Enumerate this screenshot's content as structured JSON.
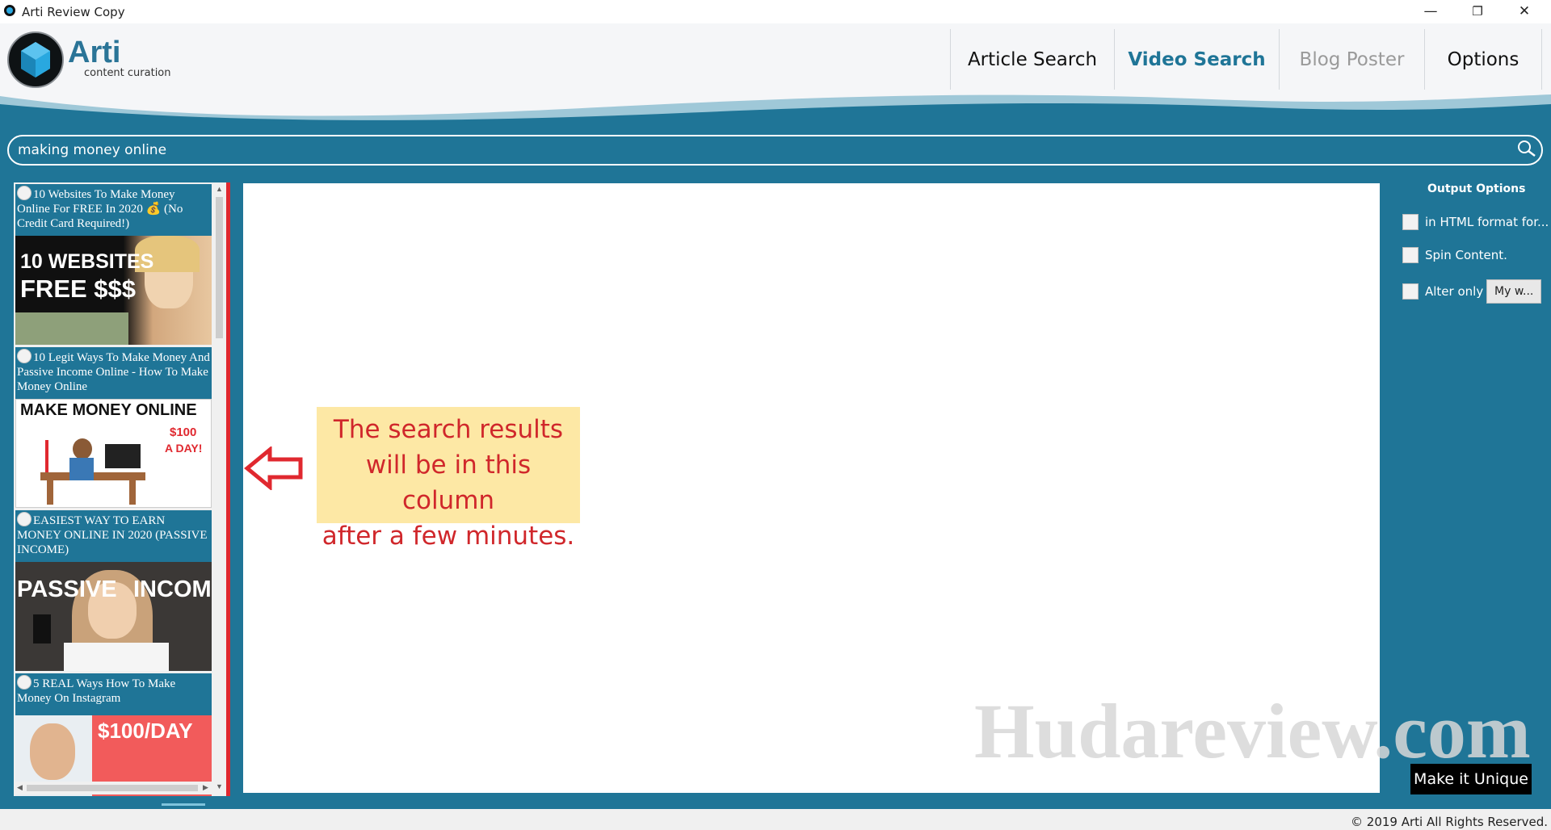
{
  "window": {
    "title": "Arti Review Copy",
    "controls": {
      "minimize": "—",
      "maximize": "❐",
      "close": "✕"
    }
  },
  "logo": {
    "name": "Arti",
    "tagline": "content curation"
  },
  "nav": [
    {
      "label": "Article Search",
      "state": "normal"
    },
    {
      "label": "Video Search",
      "state": "active"
    },
    {
      "label": "Blog Poster",
      "state": "disabled"
    },
    {
      "label": "Options",
      "state": "normal"
    }
  ],
  "search": {
    "value": "making money online",
    "icon": "search-icon"
  },
  "results": [
    {
      "title": "10 Websites To Make Money Online For FREE In 2020 💰 (No Credit Card Required!)",
      "thumb_text": [
        "10 WEBSITES",
        "FREE $$$"
      ]
    },
    {
      "title": "10 Legit Ways To Make Money And Passive Income Online - How To Make Money Online",
      "thumb_text": [
        "MAKE MONEY ONLINE",
        "$100",
        "A DAY!"
      ]
    },
    {
      "title": "EASIEST WAY TO EARN MONEY ONLINE IN 2020 (PASSIVE INCOME)",
      "thumb_text": [
        "PASSIVE",
        "INCOME"
      ]
    },
    {
      "title": "5 REAL Ways How To Make Money On Instagram",
      "thumb_text": [
        "$100/DAY"
      ]
    }
  ],
  "callout": {
    "lines": [
      "The search results",
      "will be in this column",
      "after a few minutes."
    ]
  },
  "output_options": {
    "title": "Output Options",
    "items": [
      {
        "label": "in HTML format for...",
        "checked": false
      },
      {
        "label": "Spin Content.",
        "checked": false
      },
      {
        "label": "Alter only",
        "checked": false,
        "button": "My w..."
      }
    ]
  },
  "make_unique": "Make it Unique",
  "watermark": "Hudareview.com",
  "footer": {
    "copyright": "© 2019 Arti All Rights Reserved."
  },
  "colors": {
    "accent": "#1f7597",
    "nav_active": "#1f7597",
    "callout_bg": "#fde8a5",
    "callout_text": "#d0272b"
  }
}
